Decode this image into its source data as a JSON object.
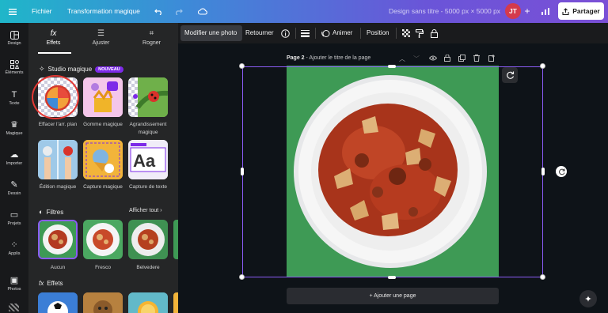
{
  "topbar": {
    "menu_icon": "hamburger-icon",
    "file_label": "Fichier",
    "magic_label": "Transformation magique",
    "design_title": "Design sans titre - 5000 px × 5000 px",
    "avatar_initials": "JT",
    "share_label": "Partager"
  },
  "leftnav": {
    "items": [
      {
        "label": "Design",
        "icon": "design-icon"
      },
      {
        "label": "Éléments",
        "icon": "elements-icon"
      },
      {
        "label": "Texte",
        "icon": "text-icon"
      },
      {
        "label": "Magique",
        "icon": "magic-icon"
      },
      {
        "label": "Importer",
        "icon": "upload-icon"
      },
      {
        "label": "Dessin",
        "icon": "draw-icon"
      },
      {
        "label": "Projets",
        "icon": "folder-icon"
      },
      {
        "label": "Applis",
        "icon": "apps-icon"
      },
      {
        "label": "Photos",
        "icon": "photos-icon"
      }
    ]
  },
  "panel": {
    "tabs": [
      {
        "label": "Effets",
        "icon": "fx-icon"
      },
      {
        "label": "Ajuster",
        "icon": "sliders-icon"
      },
      {
        "label": "Rogner",
        "icon": "crop-icon"
      }
    ],
    "studio": {
      "title": "Studio magique",
      "badge": "NOUVEAU",
      "tools": [
        {
          "label": "Effacer l'arr. plan"
        },
        {
          "label": "Gomme magique"
        },
        {
          "label": "Agrandissement magique"
        },
        {
          "label": "Édition magique"
        },
        {
          "label": "Capture magique"
        },
        {
          "label": "Capture de texte"
        }
      ]
    },
    "filters": {
      "title": "Filtres",
      "see_all": "Afficher tout",
      "items": [
        {
          "label": "Aucun"
        },
        {
          "label": "Fresco"
        },
        {
          "label": "Belvedere"
        }
      ]
    },
    "effects": {
      "title": "Effets"
    }
  },
  "ctxbar": {
    "edit_photo": "Modifier une photo",
    "flip": "Retourner",
    "animate": "Animer",
    "position": "Position"
  },
  "canvas": {
    "page_label": "Page 2",
    "page_title_placeholder": "Ajouter le titre de la page",
    "add_page": "+ Ajouter une page"
  },
  "colors": {
    "accent": "#7d2ae8",
    "selection": "#8b5cf6",
    "photo_background": "#3e9a55"
  }
}
